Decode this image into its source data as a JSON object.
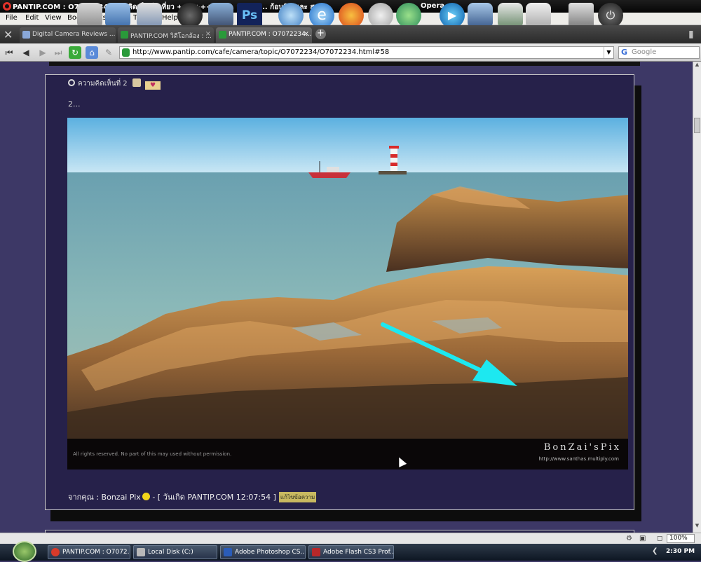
{
  "window": {
    "title": "PANTIP.COM : O7072234 ความคิดเห็น ไปเที่ยว ++++++++ ... ถ่ายรูป ... ก้อนหิน และ ส...",
    "app_name": "Opera"
  },
  "menu": [
    "File",
    "Edit",
    "View",
    "Bookmarks",
    "Tools",
    "Help"
  ],
  "tabs": [
    {
      "label": "Digital Camera Reviews ...",
      "active": false
    },
    {
      "label": "PANTIP.COM วิดีโอกล้อง : ...",
      "active": false
    },
    {
      "label": "PANTIP.COM : O7072234...",
      "active": true
    }
  ],
  "address_bar": {
    "url": "http://www.pantip.com/cafe/camera/topic/O7072234/O7072234.html#58",
    "search_placeholder": "Google"
  },
  "post": {
    "comment_header": "ความคิดเห็นที่ 2",
    "comment_text": "2...",
    "photo": {
      "copyright": "All rights reserved. No part of this may used without permission.",
      "brand": "BonZai'sPix",
      "brand_url": "http://www.santhas.multiply.com"
    },
    "footer_prefix": "จากคุณ : Bonzai Pix",
    "footer_date": " - [ วันเกิด PANTIP.COM 12:07:54 ]",
    "edit_label": "แก้ไขข้อความ"
  },
  "status_bar": {
    "zoom": "100%"
  },
  "taskbar": {
    "items": [
      {
        "label": "PANTIP.COM : O7072...",
        "color": "#d83a2a"
      },
      {
        "label": "Local Disk (C:)",
        "color": "#b8b8b8"
      },
      {
        "label": "Adobe Photoshop CS...",
        "color": "#2a5cb8"
      },
      {
        "label": "Adobe Flash CS3 Prof...",
        "color": "#b8282a"
      }
    ],
    "clock": "2:30 PM"
  }
}
